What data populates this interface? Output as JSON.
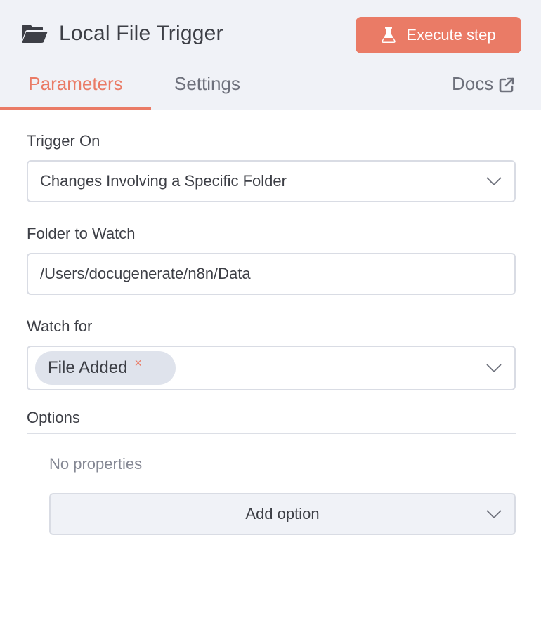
{
  "header": {
    "title": "Local File Trigger",
    "title_icon": "folder-open-icon",
    "execute_label": "Execute step",
    "execute_icon": "beaker-icon",
    "accent_color": "#ea7b66"
  },
  "tabs": [
    {
      "label": "Parameters",
      "active": true
    },
    {
      "label": "Settings",
      "active": false
    },
    {
      "label": "Docs",
      "active": false,
      "icon": "external-link-icon"
    }
  ],
  "fields": {
    "trigger_on": {
      "label": "Trigger On",
      "value": "Changes Involving a Specific Folder"
    },
    "folder_to_watch": {
      "label": "Folder to Watch",
      "value": "/Users/docugenerate/n8n/Data"
    },
    "watch_for": {
      "label": "Watch for",
      "chips": [
        "File Added"
      ],
      "chip_remove": "×"
    }
  },
  "options": {
    "label": "Options",
    "empty_text": "No properties",
    "add_label": "Add option"
  }
}
